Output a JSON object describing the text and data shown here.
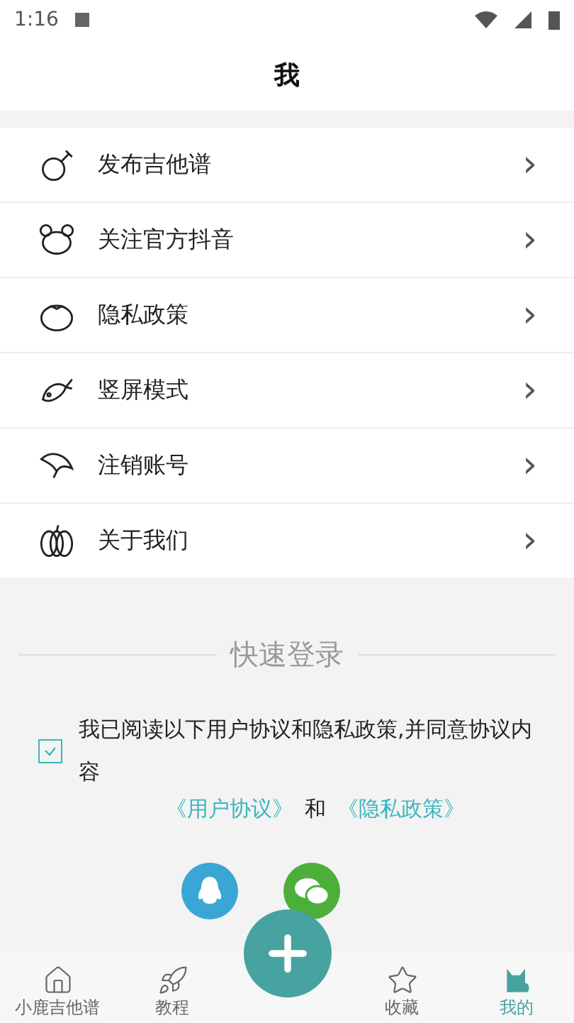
{
  "status_bar": {
    "time": "1:16"
  },
  "header": {
    "title": "我"
  },
  "menu": [
    {
      "label": "发布吉他谱",
      "chevron": "›"
    },
    {
      "label": "关注官方抖音",
      "chevron": "›"
    },
    {
      "label": "隐私政策",
      "chevron": "›"
    },
    {
      "label": "竖屏模式",
      "chevron": "›"
    },
    {
      "label": "注销账号",
      "chevron": "›"
    },
    {
      "label": "关于我们",
      "chevron": "›"
    }
  ],
  "login": {
    "title": "快速登录",
    "agree_checked": true,
    "agree_text": "我已阅读以下用户协议和隐私政策,并同意协议内容",
    "link_1": "《用户协议》",
    "joiner": "和",
    "link_2": "《隐私政策》"
  },
  "bottom_nav": [
    {
      "label": "小鹿吉他谱",
      "selected": false
    },
    {
      "label": "教程",
      "selected": false
    },
    {
      "label": "收藏",
      "selected": false
    },
    {
      "label": "我的",
      "selected": true
    }
  ]
}
